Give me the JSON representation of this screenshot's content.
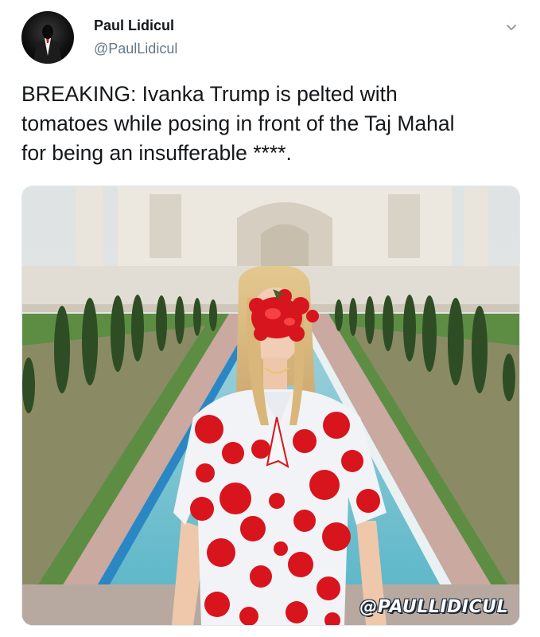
{
  "author": {
    "display_name": "Paul Lidicul",
    "handle": "@PaulLidicul",
    "avatar_icon": "tuxedo-silhouette-icon"
  },
  "menu": {
    "icon": "chevron-down-icon"
  },
  "tweet": {
    "text": "BREAKING:  Ivanka Trump is pelted with\ntomatoes while posing in front of the Taj Mahal\nfor being an insufferable ****."
  },
  "media": {
    "watermark": "@PAULLIDICUL",
    "colors": {
      "dress_red": "#d8141c",
      "sky": "#dfe4e6",
      "pool": "#7ec7d6",
      "grass": "#4e8a3a"
    }
  }
}
